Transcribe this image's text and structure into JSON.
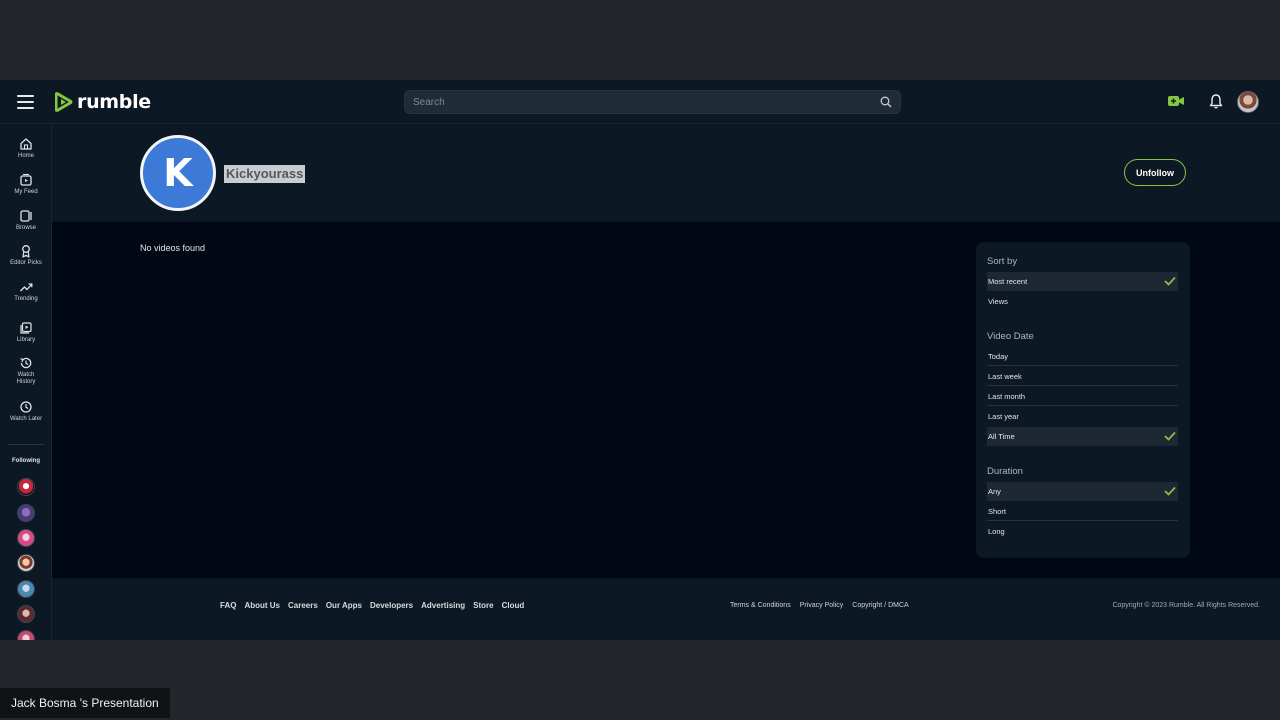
{
  "app": {
    "logo_text": "rumble",
    "brand_color": "#85c742"
  },
  "search": {
    "placeholder": "Search"
  },
  "sidebar": {
    "items": [
      {
        "label": "Home",
        "icon": "home-icon"
      },
      {
        "label": "My Feed",
        "icon": "feed-icon"
      },
      {
        "label": "Browse",
        "icon": "browse-icon"
      },
      {
        "label": "Editor Picks",
        "icon": "award-icon"
      },
      {
        "label": "Trending",
        "icon": "trending-icon"
      },
      {
        "label": "Library",
        "icon": "library-icon"
      },
      {
        "label": "Watch History",
        "icon": "history-icon"
      },
      {
        "label": "Watch Later",
        "icon": "clock-icon"
      }
    ],
    "following_label": "Following"
  },
  "channel": {
    "initial": "K",
    "name": "Kickyourass",
    "unfollow_label": "Unfollow"
  },
  "main": {
    "empty_text": "No videos found"
  },
  "filters": {
    "sort_by": {
      "heading": "Sort by",
      "options": [
        {
          "label": "Most recent",
          "selected": true
        },
        {
          "label": "Views",
          "selected": false
        }
      ]
    },
    "video_date": {
      "heading": "Video Date",
      "options": [
        {
          "label": "Today",
          "selected": false
        },
        {
          "label": "Last week",
          "selected": false
        },
        {
          "label": "Last month",
          "selected": false
        },
        {
          "label": "Last year",
          "selected": false
        },
        {
          "label": "All Time",
          "selected": true
        }
      ]
    },
    "duration": {
      "heading": "Duration",
      "options": [
        {
          "label": "Any",
          "selected": true
        },
        {
          "label": "Short",
          "selected": false
        },
        {
          "label": "Long",
          "selected": false
        }
      ]
    }
  },
  "footer": {
    "links": [
      "FAQ",
      "About Us",
      "Careers",
      "Our Apps",
      "Developers",
      "Advertising",
      "Store",
      "Cloud"
    ],
    "legal": [
      "Terms & Conditions",
      "Privacy Policy",
      "Copyright / DMCA"
    ],
    "copyright": "Copyright © 2023 Rumble. All Rights Reserved."
  },
  "presenter_label": "Jack Bosma 's Presentation"
}
